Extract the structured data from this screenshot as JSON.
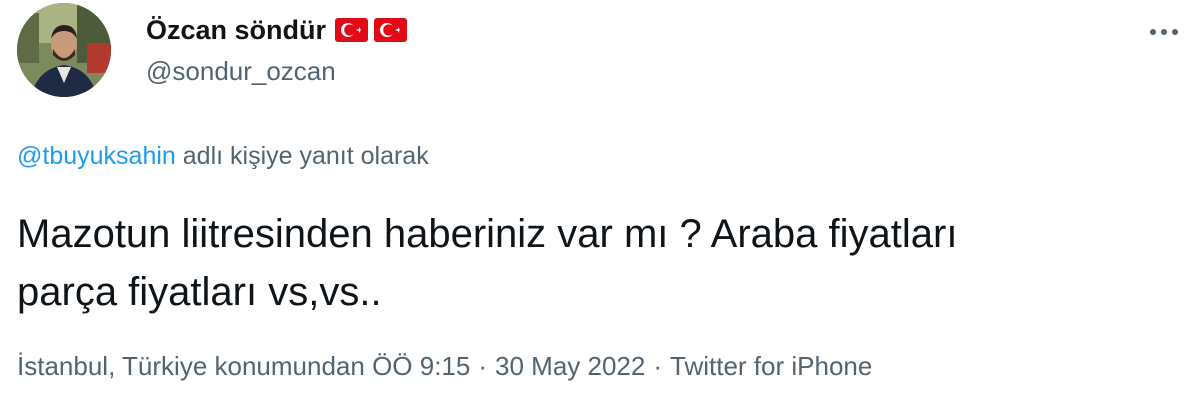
{
  "author": {
    "display_name": "Özcan söndür",
    "handle": "@sondur_ozcan",
    "flags": [
      "turkey-flag",
      "turkey-flag"
    ],
    "avatar": "profile-photo"
  },
  "reply": {
    "mention": "@tbuyuksahin",
    "suffix": "adlı kişiye yanıt olarak"
  },
  "tweet": {
    "line1": "Mazotun liitresinden haberiniz var mı ? Araba fiyatları",
    "line2": "parça fiyatları vs,vs.."
  },
  "meta": {
    "location_time": "İstanbul, Türkiye konumundan ÖÖ 9:15",
    "separator": "·",
    "date": "30 May 2022",
    "source": "Twitter for iPhone"
  },
  "icons": {
    "more": "more-horizontal-icon"
  },
  "colors": {
    "link": "#1d9bf0",
    "secondary_text": "#536471",
    "primary_text": "#0f1419",
    "flag_red": "#e30a17"
  }
}
